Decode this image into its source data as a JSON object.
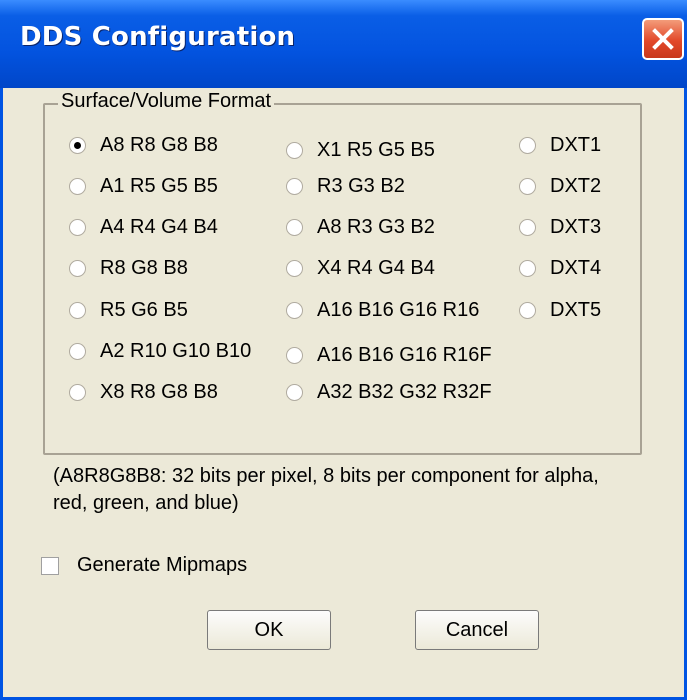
{
  "window": {
    "title": "DDS Configuration",
    "close_icon": "close-icon"
  },
  "surface_format": {
    "legend": "Surface/Volume Format",
    "selected": "A8 R8 G8 B8",
    "col1": [
      "A8 R8 G8 B8",
      "A1 R5 G5 B5",
      "A4 R4 G4 B4",
      "R8 G8 B8",
      "R5 G6 B5",
      "A2 R10 G10 B10",
      "X8 R8 G8 B8"
    ],
    "col2": [
      "X1 R5 G5 B5",
      "R3 G3 B2",
      "A8 R3 G3 B2",
      "X4 R4 G4 B4",
      "A16 B16 G16 R16",
      "A16 B16 G16 R16F",
      "A32 B32 G32 R32F"
    ],
    "col3": [
      "DXT1",
      "DXT2",
      "DXT3",
      "DXT4",
      "DXT5"
    ]
  },
  "description": "(A8R8G8B8: 32 bits per pixel, 8 bits per component for alpha, red, green, and blue)",
  "mipmaps": {
    "label": "Generate Mipmaps",
    "checked": false
  },
  "buttons": {
    "ok": "OK",
    "cancel": "Cancel"
  },
  "colors": {
    "titlebar": "#0353df",
    "dialog_bg": "#ece9d8",
    "close": "#e2492a"
  }
}
